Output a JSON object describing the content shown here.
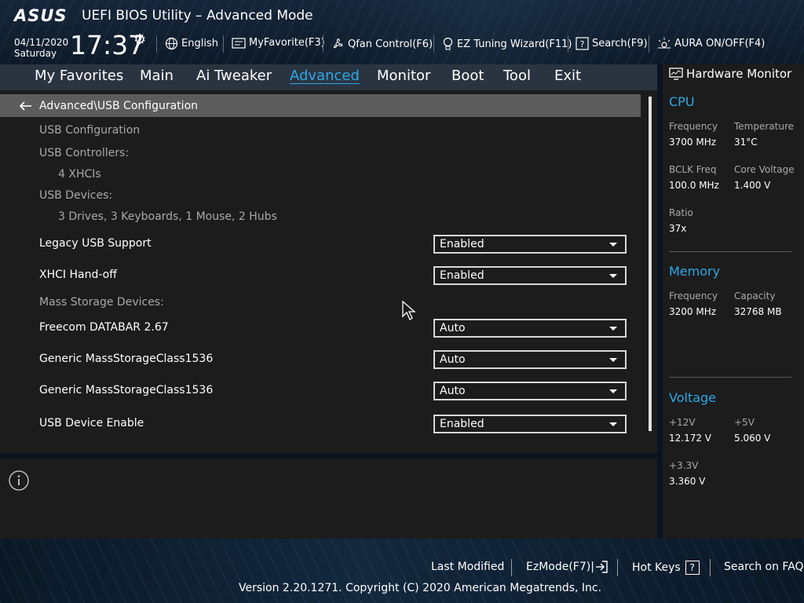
{
  "header": {
    "logo_text": "ASUS",
    "title": "UEFI BIOS Utility – Advanced Mode",
    "date": "04/11/2020",
    "day": "Saturday",
    "time": "17:37",
    "tools": [
      {
        "label": "English",
        "icon": "globe-icon"
      },
      {
        "label": "MyFavorite(F3)",
        "icon": "favorite-icon"
      },
      {
        "label": "Qfan Control(F6)",
        "icon": "fan-icon"
      },
      {
        "label": "EZ Tuning Wizard(F11)",
        "icon": "bulb-icon"
      },
      {
        "label": "Search(F9)",
        "icon": "question-icon"
      },
      {
        "label": "AURA ON/OFF(F4)",
        "icon": "aura-icon"
      }
    ]
  },
  "nav": {
    "tabs": [
      {
        "label": "My Favorites"
      },
      {
        "label": "Main"
      },
      {
        "label": "Ai Tweaker"
      },
      {
        "label": "Advanced"
      },
      {
        "label": "Monitor"
      },
      {
        "label": "Boot"
      },
      {
        "label": "Tool"
      },
      {
        "label": "Exit"
      }
    ],
    "active": "Advanced",
    "accent_color": "#2ea8e6"
  },
  "main": {
    "breadcrumb": "Advanced\\USB Configuration",
    "section_title": "USB Configuration",
    "usb_controllers_label": "USB Controllers:",
    "usb_controllers_value": "4 XHCIs",
    "usb_devices_label": "USB Devices:",
    "usb_devices_value": "3 Drives, 3 Keyboards, 1 Mouse, 2 Hubs",
    "mass_storage_label": "Mass Storage Devices:",
    "settings": [
      {
        "label": "Legacy USB Support",
        "value": "Enabled"
      },
      {
        "label": "XHCI Hand-off",
        "value": "Enabled"
      },
      {
        "label": "Freecom DATABAR 2.67",
        "value": "Auto"
      },
      {
        "label": "Generic MassStorageClass1536",
        "value": "Auto"
      },
      {
        "label": "Generic MassStorageClass1536",
        "value": "Auto"
      },
      {
        "label": "USB Device Enable",
        "value": "Enabled"
      }
    ]
  },
  "hardware_monitor": {
    "title": "Hardware Monitor",
    "cpu": {
      "title": "CPU",
      "frequency_label": "Frequency",
      "frequency": "3700 MHz",
      "temperature_label": "Temperature",
      "temperature": "31°C",
      "bclk_label": "BCLK Freq",
      "bclk": "100.0 MHz",
      "core_voltage_label": "Core Voltage",
      "core_voltage": "1.400 V",
      "ratio_label": "Ratio",
      "ratio": "37x"
    },
    "memory": {
      "title": "Memory",
      "frequency_label": "Frequency",
      "frequency": "3200 MHz",
      "capacity_label": "Capacity",
      "capacity": "32768 MB"
    },
    "voltage": {
      "title": "Voltage",
      "v12_label": "+12V",
      "v12": "12.172 V",
      "v5_label": "+5V",
      "v5": "5.060 V",
      "v33_label": "+3.3V",
      "v33": "3.360 V"
    }
  },
  "footer": {
    "last_modified": "Last Modified",
    "ezmode": "EzMode(F7)|",
    "hot_keys": "Hot Keys",
    "hot_keys_box": "?",
    "search_faq": "Search on FAQ",
    "copyright": "Version 2.20.1271. Copyright (C) 2020 American Megatrends, Inc."
  }
}
